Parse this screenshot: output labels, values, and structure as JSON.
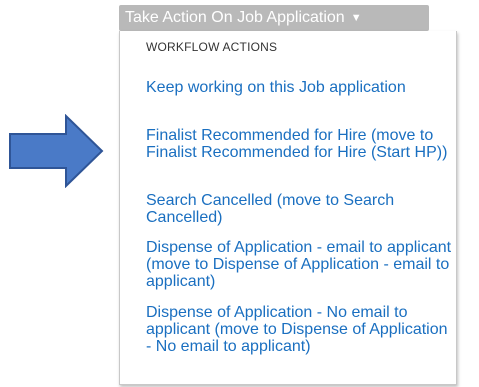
{
  "toolbar": {
    "action_button_label": "Take Action On Job Application",
    "caret_icon": "caret-down-icon"
  },
  "menu": {
    "section_heading": "WORKFLOW ACTIONS",
    "items": [
      {
        "label": "Keep working on this Job application"
      },
      {
        "label": "Finalist Recommended for Hire (move to Finalist Recommended for Hire (Start HP))"
      },
      {
        "label": "Search Cancelled (move to Search Cancelled)"
      },
      {
        "label": "Dispense of Application - email to applicant (move to Dispense of Application - email to applicant)"
      },
      {
        "label": "Dispense of Application - No email to applicant (move to Dispense of Application - No email to applicant)"
      }
    ]
  },
  "annotation": {
    "arrow_icon": "right-arrow-icon",
    "arrow_color": "#4a7ac7",
    "arrow_outline_color": "#2f5597"
  },
  "colors": {
    "link": "#1a6fc0",
    "button_bg": "#b9b9b9",
    "button_text": "#ffffff"
  }
}
